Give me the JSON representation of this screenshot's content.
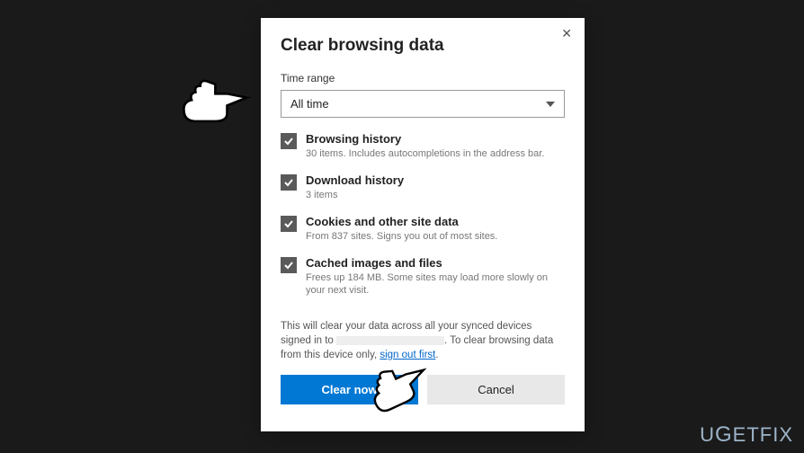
{
  "dialog": {
    "title": "Clear browsing data",
    "time_range_label": "Time range",
    "time_range_value": "All time",
    "options": [
      {
        "title": "Browsing history",
        "desc": "30 items. Includes autocompletions in the address bar."
      },
      {
        "title": "Download history",
        "desc": "3 items"
      },
      {
        "title": "Cookies and other site data",
        "desc": "From 837 sites. Signs you out of most sites."
      },
      {
        "title": "Cached images and files",
        "desc": "Frees up 184 MB. Some sites may load more slowly on your next visit."
      }
    ],
    "info_pre": "This will clear your data across all your synced devices signed in to ",
    "info_mid": ". To clear browsing data from this device only, ",
    "sign_out_link": "sign out first",
    "info_end": ".",
    "clear_label": "Clear now",
    "cancel_label": "Cancel"
  },
  "watermark": "UGETFIX"
}
